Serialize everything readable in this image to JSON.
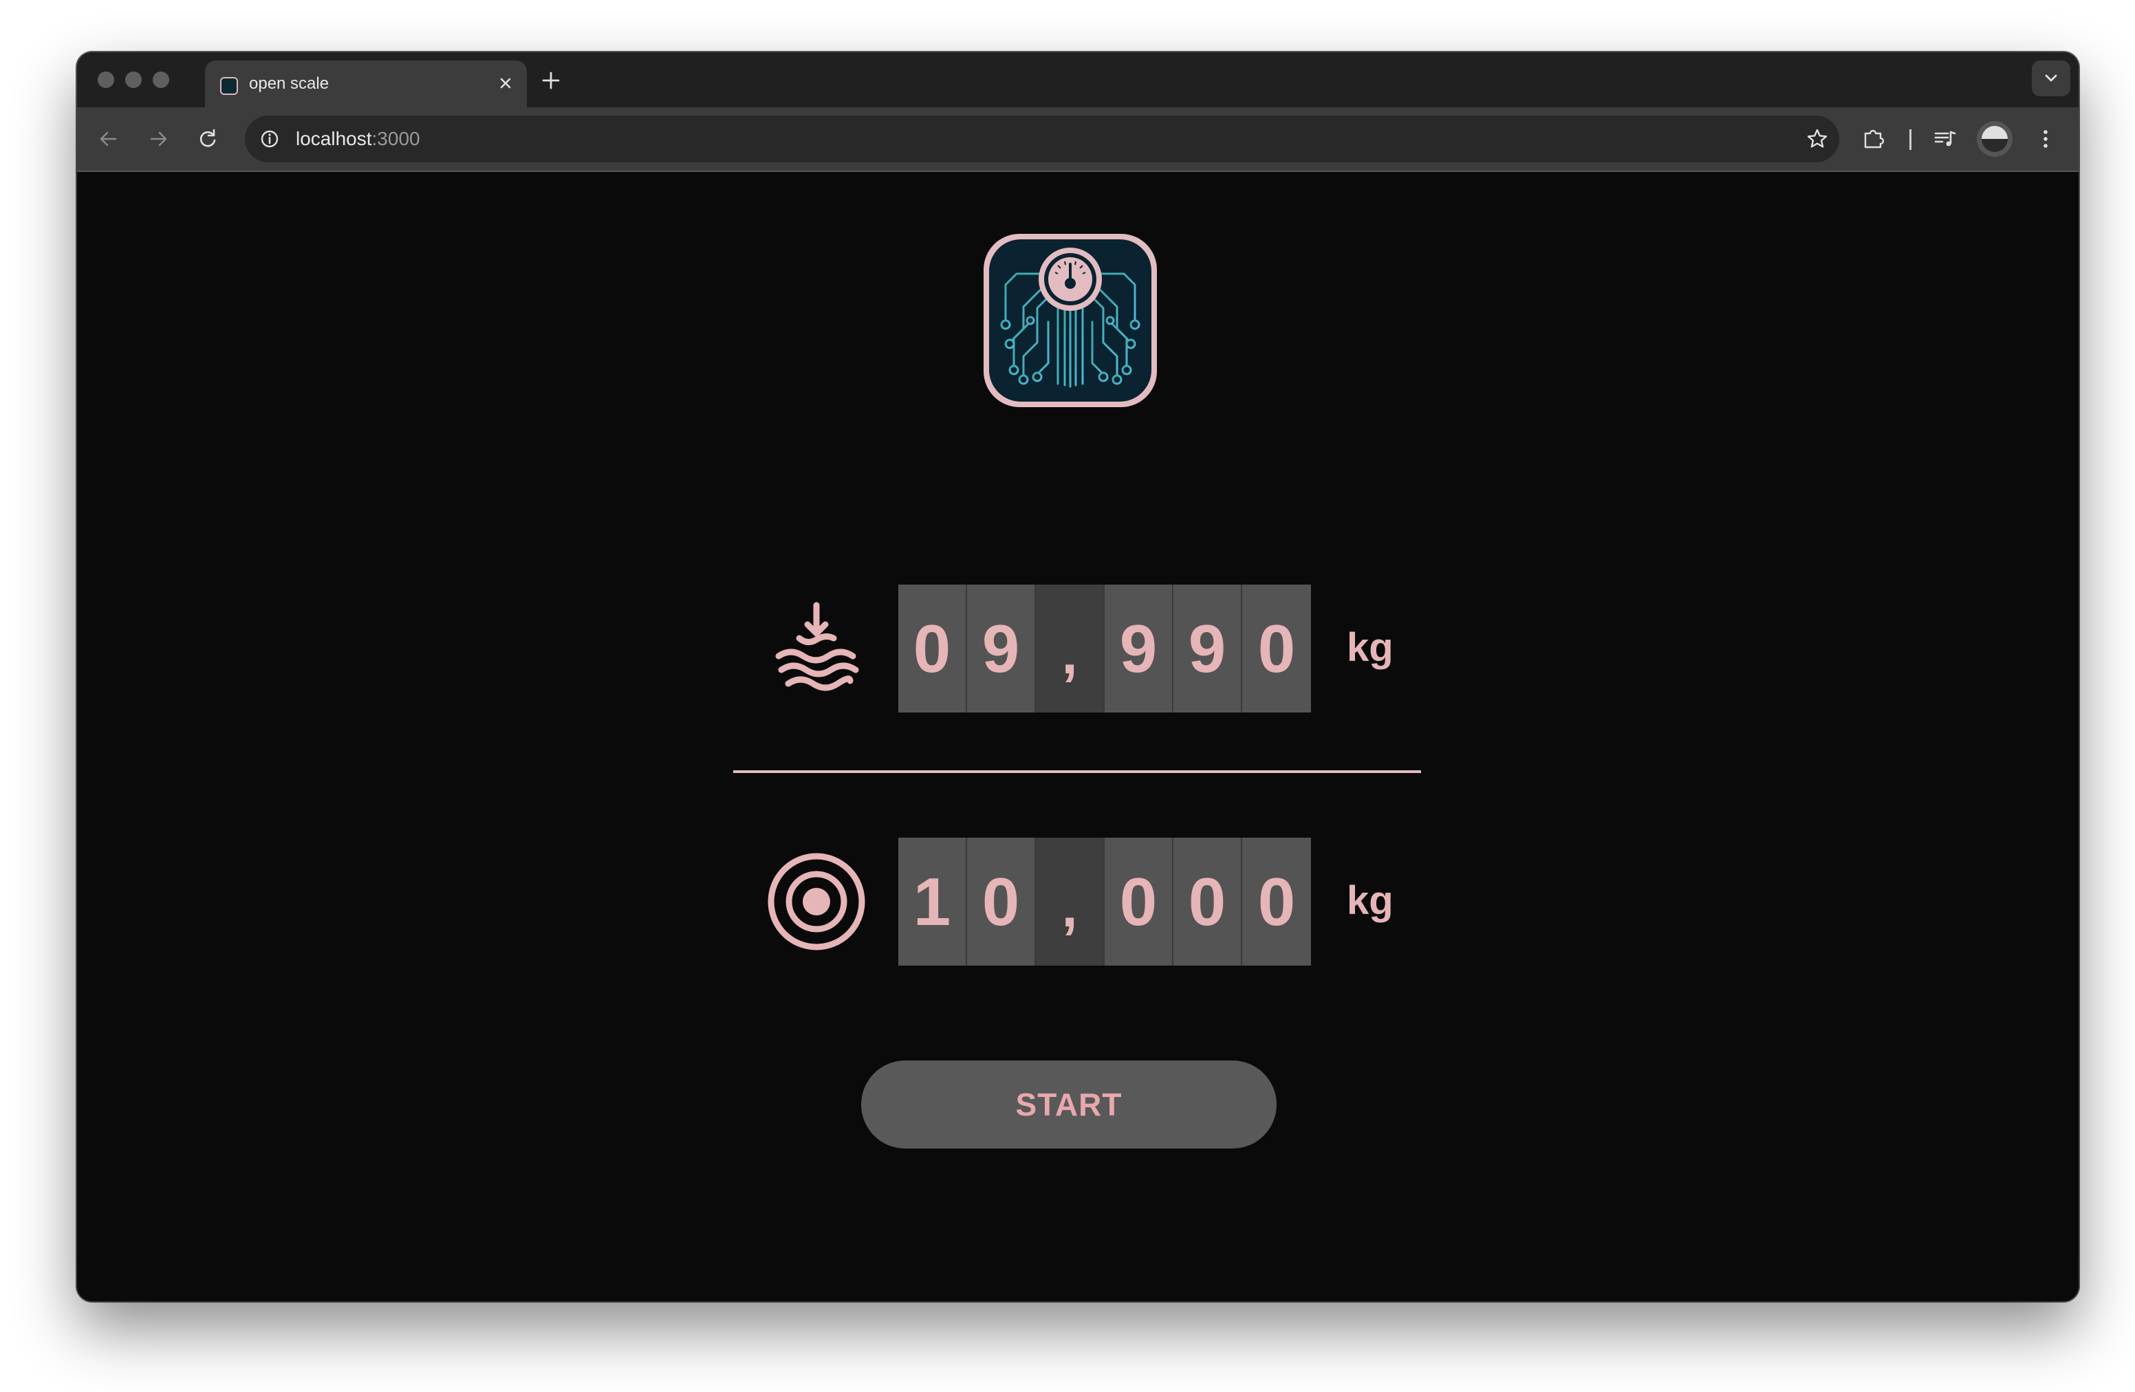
{
  "browser": {
    "tab_title": "open scale",
    "url_host": "localhost",
    "url_port": ":3000"
  },
  "scale": {
    "current": {
      "digits": [
        "0",
        "9",
        ",",
        "9",
        "9",
        "0"
      ],
      "unit": "kg",
      "icon": "weight-down-waves-icon"
    },
    "target": {
      "digits": [
        "1",
        "0",
        ",",
        "0",
        "0",
        "0"
      ],
      "unit": "kg",
      "icon": "target-icon"
    },
    "start_label": "START"
  },
  "colors": {
    "accent": "#e6b5b7",
    "background": "#0a0a0a",
    "digit_tile": "#545454",
    "button": "#595959"
  }
}
